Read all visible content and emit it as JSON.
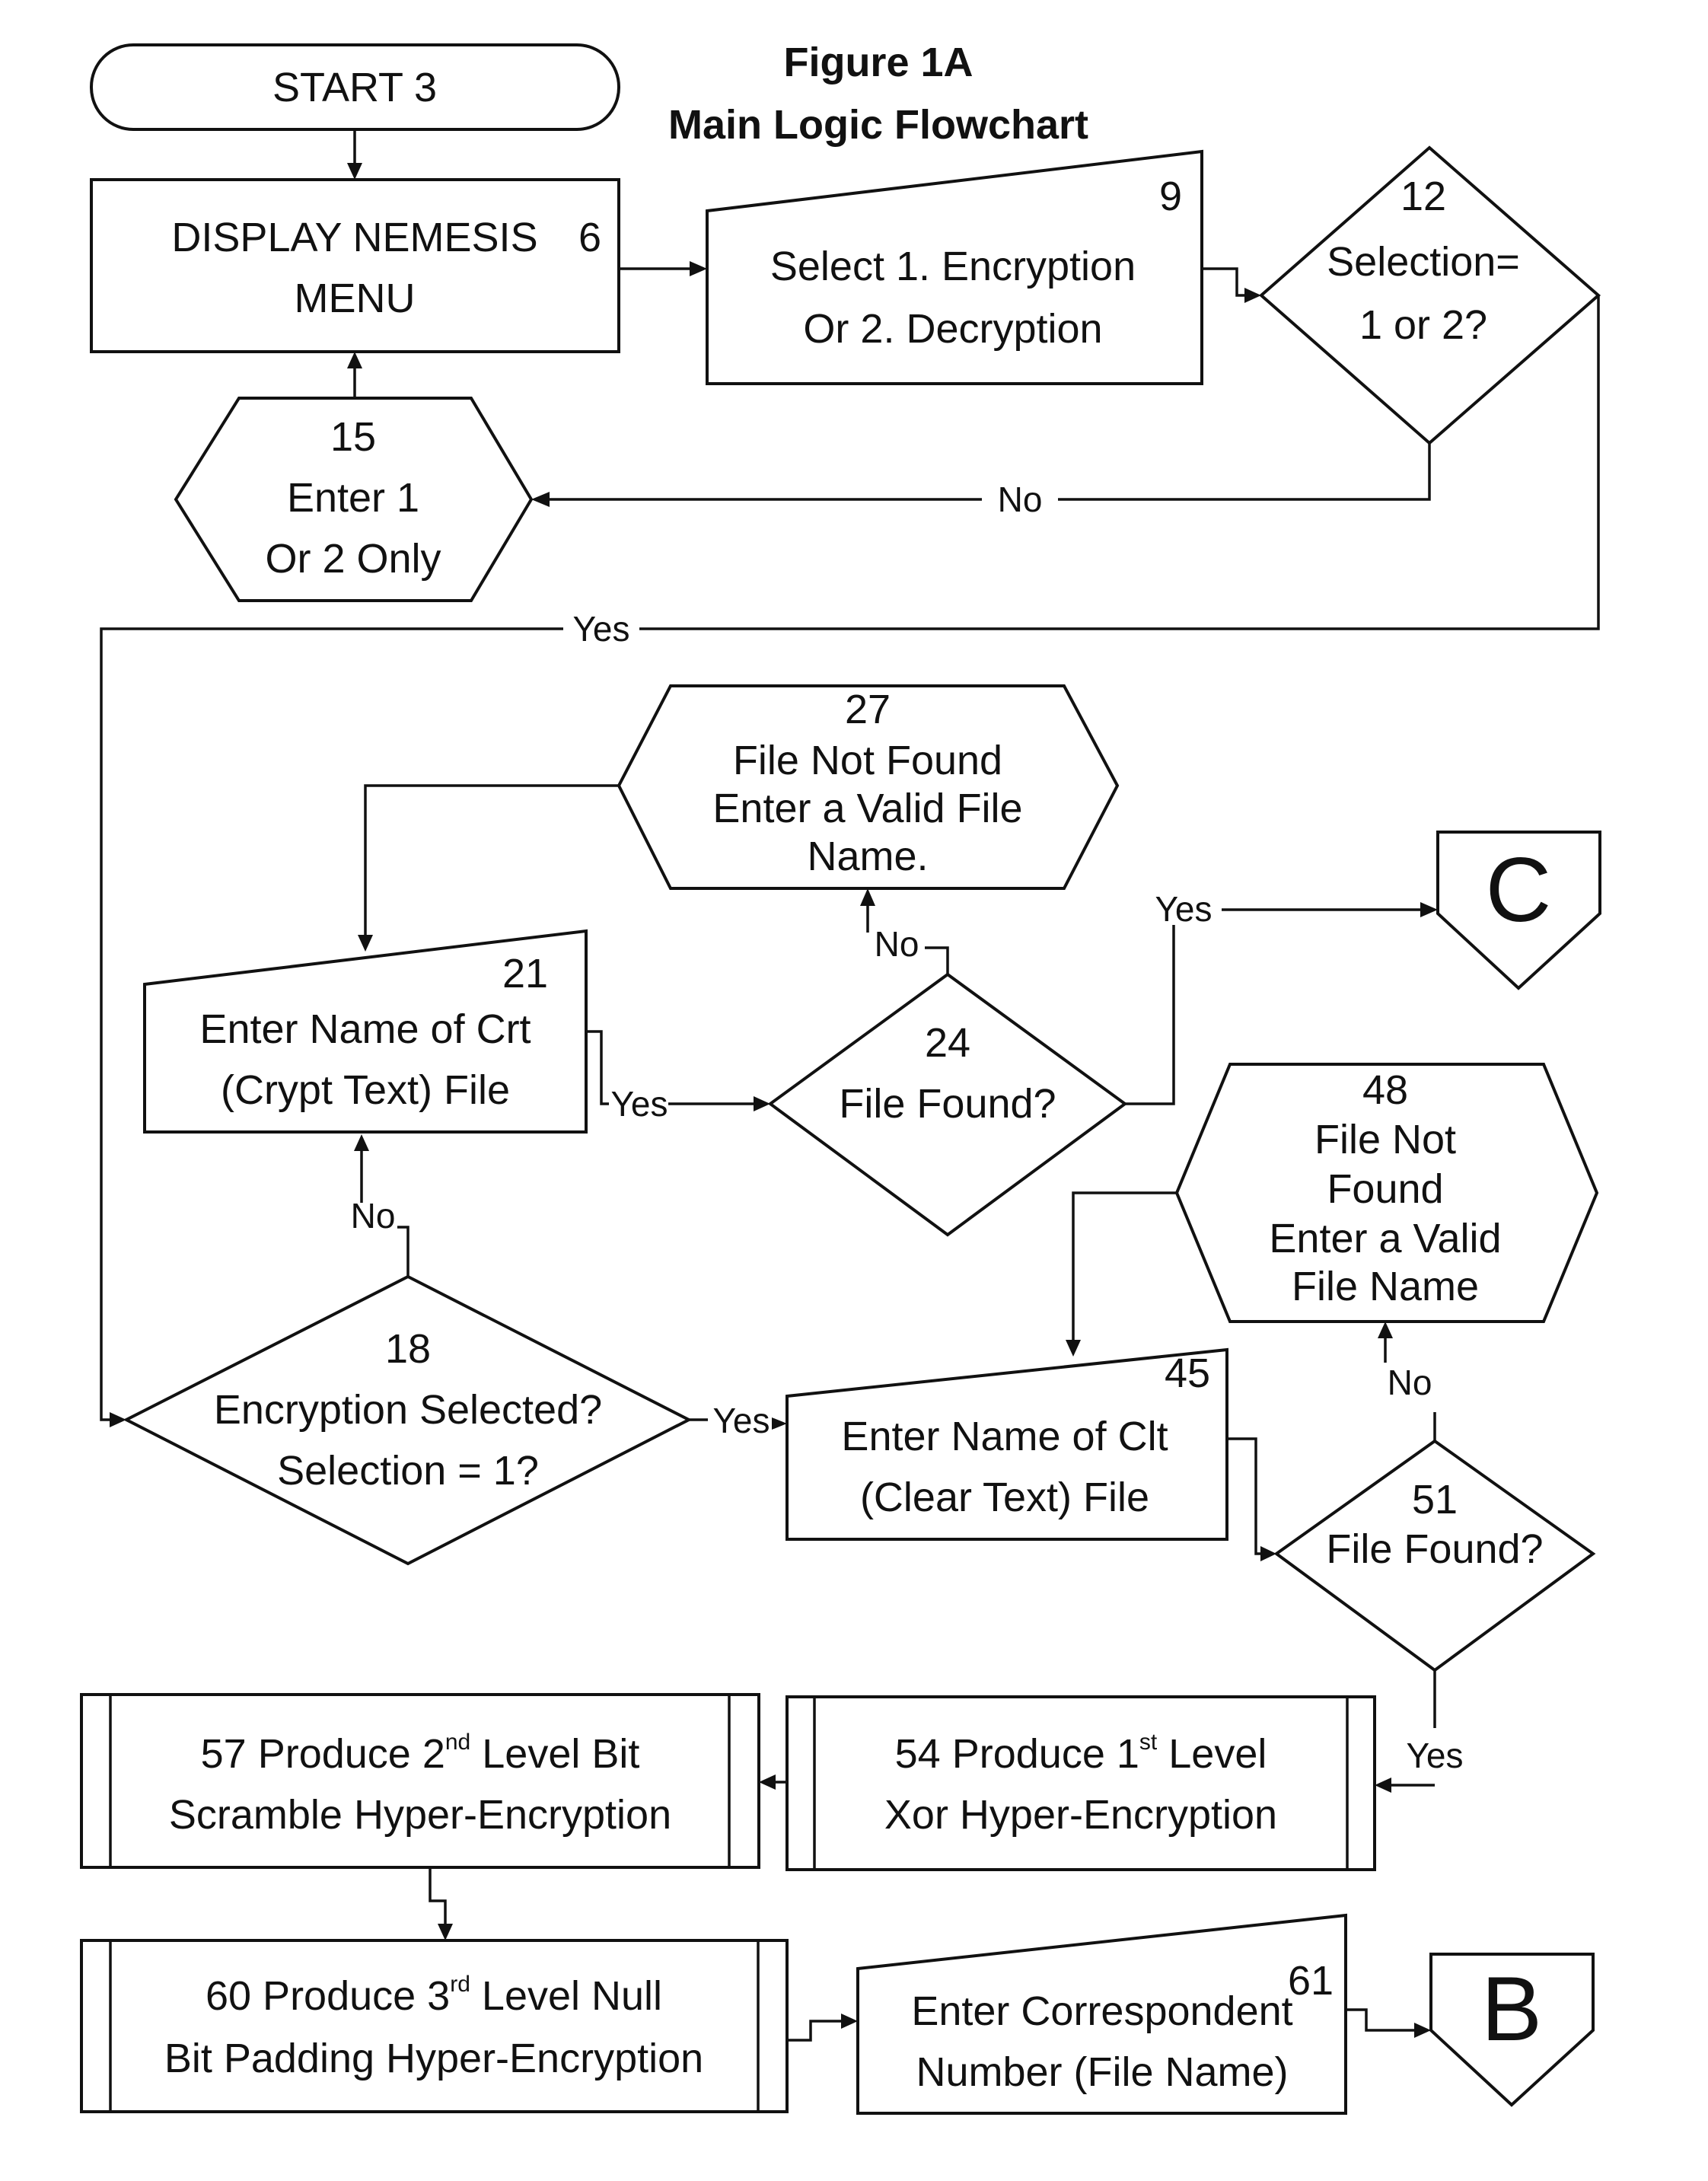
{
  "title": {
    "line1": "Figure 1A",
    "line2": "Main Logic Flowchart"
  },
  "nodes": {
    "start": {
      "text": "START 3"
    },
    "display_menu": {
      "line1": "DISPLAY NEMESIS",
      "number": "6",
      "line2": "MENU"
    },
    "select": {
      "number": "9",
      "line1": "Select 1. Encryption",
      "line2": "Or 2. Decryption"
    },
    "selection_check": {
      "number": "12",
      "line1": "Selection=",
      "line2": "1 or 2?"
    },
    "enter_only": {
      "number": "15",
      "line1": "Enter 1",
      "line2": "Or 2 Only"
    },
    "encryption_selected": {
      "number": "18",
      "line1": "Encryption Selected?",
      "line2": "Selection = 1?"
    },
    "enter_crt": {
      "number": "21",
      "line1": "Enter Name of Crt",
      "line2": "(Crypt Text) File"
    },
    "file_found_24": {
      "number": "24",
      "line1": "File Found?"
    },
    "file_not_found_27": {
      "number": "27",
      "line1": "File Not Found",
      "line2": "Enter a Valid File",
      "line3": "Name."
    },
    "enter_clt": {
      "number": "45",
      "line1": "Enter Name of Clt",
      "line2": "(Clear Text) File"
    },
    "file_not_found_48": {
      "number": "48",
      "line1": "File Not",
      "line2": "Found",
      "line3": "Enter a Valid",
      "line4": "File Name"
    },
    "file_found_51": {
      "number": "51",
      "line1": "File Found?"
    },
    "level1": {
      "number": "54",
      "pre": "Produce 1",
      "sup": "st",
      "post": " Level",
      "line2": "Xor Hyper-Encryption"
    },
    "level2": {
      "number": "57",
      "pre": "Produce 2",
      "sup": "nd",
      "post": " Level Bit",
      "line2": "Scramble Hyper-Encryption"
    },
    "level3": {
      "number": "60",
      "pre": "Produce 3",
      "sup": "rd",
      "post": " Level Null",
      "line2": "Bit Padding Hyper-Encryption"
    },
    "enter_correspondent": {
      "number": "61",
      "line1": "Enter Correspondent",
      "line2": "Number (File Name)"
    },
    "connector_c": {
      "text": "C"
    },
    "connector_b": {
      "text": "B"
    }
  },
  "edge_labels": {
    "no_12_15": "No",
    "yes_12_18": "Yes",
    "no_18_21": "No",
    "yes_18_45": "Yes",
    "yes_21_24": "Yes",
    "no_24_27": "No",
    "yes_24_c": "Yes",
    "no_51_48": "No",
    "yes_51_54": "Yes"
  }
}
